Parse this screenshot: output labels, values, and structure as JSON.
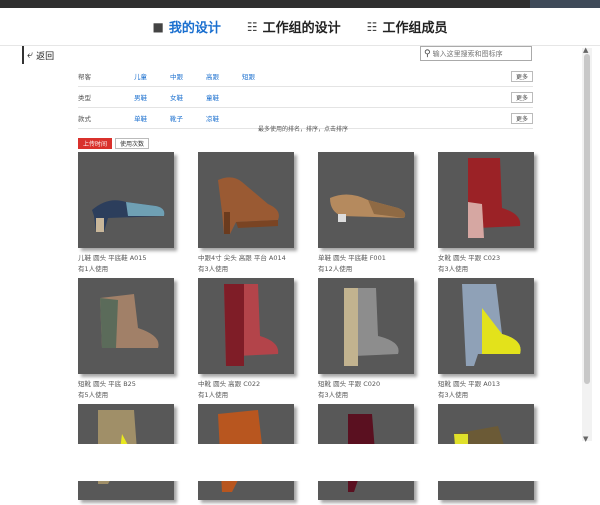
{
  "nav": {
    "tabs": [
      {
        "label": "我的设计",
        "icon": "folder-icon",
        "active": true
      },
      {
        "label": "工作组的设计",
        "icon": "network-icon",
        "active": false
      },
      {
        "label": "工作组成员",
        "icon": "members-icon",
        "active": false
      }
    ]
  },
  "toolbar": {
    "back_label": "返回",
    "search_placeholder": "输入这里搜索和图标序"
  },
  "filters": [
    {
      "label": "帮客",
      "options": [
        "儿童",
        "中跟",
        "高跟",
        "短跟"
      ],
      "more": "更多"
    },
    {
      "label": "类型",
      "options": [
        "男鞋",
        "女鞋",
        "童鞋"
      ],
      "more": "更多"
    },
    {
      "label": "款式",
      "options": [
        "单鞋",
        "靴子",
        "凉鞋"
      ],
      "more": "更多"
    }
  ],
  "sort": {
    "hint": "最多使用的排名，排序，点击排序",
    "buttons": [
      {
        "label": "上传时间",
        "active": true
      },
      {
        "label": "使用次数",
        "active": false
      }
    ]
  },
  "cards": [
    {
      "name": "儿鞋 圆头 平底鞋 A015",
      "used": "有1人使用",
      "shoe": "pump-navy"
    },
    {
      "name": "中跟4寸 尖头 高跟 平台 A014",
      "used": "有3人使用",
      "shoe": "platform-brown"
    },
    {
      "name": "单鞋 圆头 平底鞋 F001",
      "used": "有12人使用",
      "shoe": "flat-tan"
    },
    {
      "name": "女靴 圆头 平跟 C023",
      "used": "有3人使用",
      "shoe": "boot-red"
    },
    {
      "name": "短靴 圆头 平底 B25",
      "used": "有5人使用",
      "shoe": "ankle-tan"
    },
    {
      "name": "中靴 圆头 高跟 C022",
      "used": "有1人使用",
      "shoe": "boot-floral"
    },
    {
      "name": "短靴 圆头 平跟 C020",
      "used": "有3人使用",
      "shoe": "boot-snake"
    },
    {
      "name": "短靴 圆头 平跟 A013",
      "used": "有3人使用",
      "shoe": "boot-yellow"
    },
    {
      "name": "",
      "used": "",
      "shoe": "boot-camo-yellow"
    },
    {
      "name": "",
      "used": "",
      "shoe": "boot-orange"
    },
    {
      "name": "",
      "used": "",
      "shoe": "boot-burgundy"
    },
    {
      "name": "",
      "used": "",
      "shoe": "boot-leopard"
    }
  ],
  "colors": {
    "accent": "#1a6fcf",
    "sort_active": "#d9312c",
    "thumb_bg": "#585858"
  }
}
